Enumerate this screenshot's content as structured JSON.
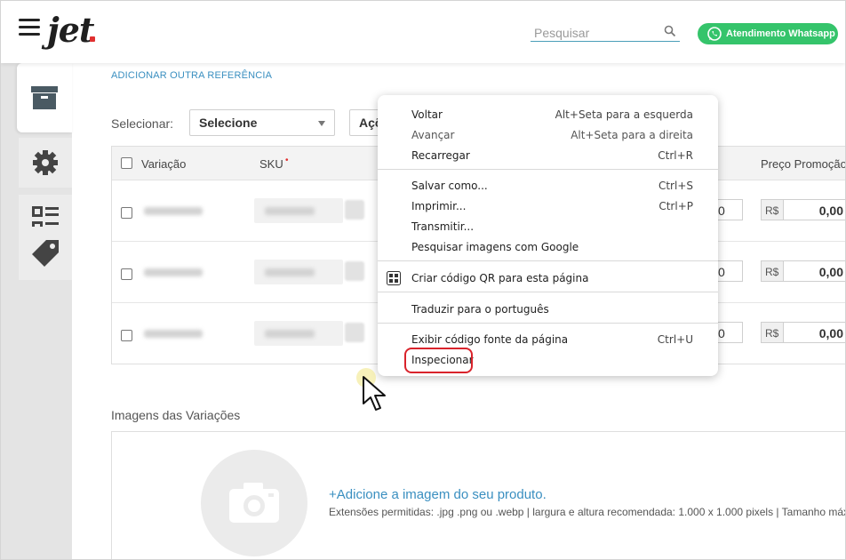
{
  "header": {
    "logo_text": "jet",
    "search_placeholder": "Pesquisar",
    "whatsapp_label": "Atendimento Whatsapp"
  },
  "colors": {
    "accent_link": "#3a8fc0",
    "whatsapp_green": "#35c46b",
    "highlight_red": "#d9232b",
    "logo_dot": "#e03030"
  },
  "sidebar": {
    "tabs": [
      {
        "icon": "box-icon",
        "active": true
      },
      {
        "icon": "gear-icon",
        "active": false
      },
      {
        "icon": "grid-list-icon",
        "active": false
      },
      {
        "icon": "tag-icon",
        "active": false
      }
    ]
  },
  "main": {
    "add_reference_link": "ADICIONAR OUTRA REFERÊNCIA",
    "select_label": "Selecionar:",
    "select_value": "Selecione",
    "actions_value": "Açõ",
    "table": {
      "columns": [
        "Variação",
        "SKU",
        "Preço Promoção"
      ],
      "sku_required_mark": "•",
      "rows": [
        {
          "price_edge": "0",
          "currency": "R$",
          "promo_price": "0,00"
        },
        {
          "price_edge": "0",
          "currency": "R$",
          "promo_price": "0,00"
        },
        {
          "price_edge": "0",
          "currency": "R$",
          "promo_price": "0,00"
        }
      ]
    },
    "images": {
      "title": "Imagens das Variações",
      "add_link": "+Adicione a imagem do seu produto.",
      "extensions_text": "Extensões permitidas: .jpg .png ou .webp | largura e altura recomendada: 1.000 x 1.000 pixels | Tamanho máx"
    }
  },
  "context_menu": {
    "items": [
      {
        "label": "Voltar",
        "shortcut": "Alt+Seta para a esquerda"
      },
      {
        "label": "Avançar",
        "shortcut": "Alt+Seta para a direita"
      },
      {
        "label": "Recarregar",
        "shortcut": "Ctrl+R"
      },
      {
        "label": "Salvar como...",
        "shortcut": "Ctrl+S"
      },
      {
        "label": "Imprimir...",
        "shortcut": "Ctrl+P"
      },
      {
        "label": "Transmitir...",
        "shortcut": ""
      },
      {
        "label": "Pesquisar imagens com Google",
        "shortcut": ""
      },
      {
        "label": "Criar código QR para esta página",
        "shortcut": ""
      },
      {
        "label": "Traduzir para o português",
        "shortcut": ""
      },
      {
        "label": "Exibir código fonte da página",
        "shortcut": "Ctrl+U"
      },
      {
        "label": "Inspecionar",
        "shortcut": ""
      }
    ]
  }
}
